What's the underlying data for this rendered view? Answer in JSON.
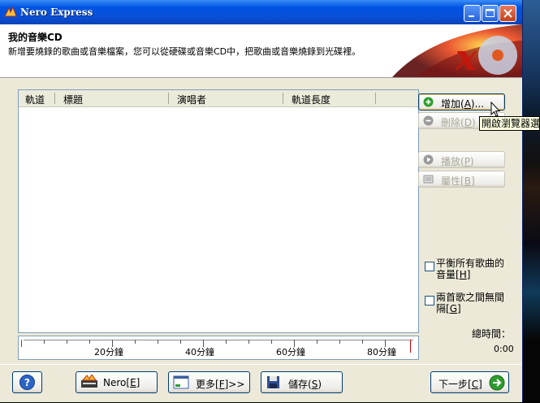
{
  "window": {
    "title": "Nero Express"
  },
  "header": {
    "title": "我的音樂CD",
    "description": "新增要燒錄的歌曲或音樂檔案，您可以從硬碟或音樂CD中，把歌曲或音樂燒錄到光碟裡。"
  },
  "list": {
    "columns": [
      "軌道",
      "標題",
      "演唱者",
      "軌道長度"
    ]
  },
  "timeline": {
    "labels": [
      "20分鐘",
      "40分鐘",
      "60分鐘",
      "80分鐘"
    ]
  },
  "side_buttons": {
    "add": {
      "label": "增加",
      "key": "A",
      "suffix": "..."
    },
    "delete": {
      "label": "刪除",
      "key": "D"
    },
    "play": {
      "label": "播放",
      "key": "P"
    },
    "properties": {
      "label": "屬性",
      "key": "B"
    }
  },
  "tooltip": "開啟瀏覽器選",
  "options": {
    "normalize": {
      "line1": "平衡所有歌曲的",
      "line2": "音量",
      "key": "H"
    },
    "no_gap": {
      "line1": "兩首歌之間無間",
      "line2": "隔",
      "key": "G"
    }
  },
  "total": {
    "label": "總時間：",
    "value": "0:00"
  },
  "bottom": {
    "nero": {
      "label": "Nero",
      "key": "E"
    },
    "more": {
      "label": "更多",
      "key": "F",
      "suffix": ">>"
    },
    "save": {
      "label": "儲存",
      "key": "S"
    },
    "next": {
      "label": "下一步",
      "key": "C"
    }
  },
  "colors": {
    "titlebar": "#0054e3",
    "window_bg": "#ece9d8",
    "accent_green": "#2e9c2e"
  }
}
